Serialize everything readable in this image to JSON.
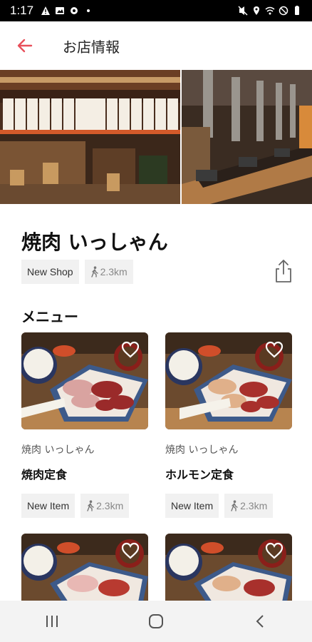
{
  "status": {
    "time": "1:17"
  },
  "header": {
    "title": "お店情報"
  },
  "shop": {
    "name": "焼肉 いっしゃん",
    "tag": "New Shop",
    "distance": "2.3km"
  },
  "menu": {
    "section_title": "メニュー",
    "items": [
      {
        "shop": "焼肉 いっしゃん",
        "name": "焼肉定食",
        "tag": "New Item",
        "distance": "2.3km"
      },
      {
        "shop": "焼肉 いっしゃん",
        "name": "ホルモン定食",
        "tag": "New Item",
        "distance": "2.3km"
      },
      {
        "shop": "",
        "name": "",
        "tag": "",
        "distance": ""
      },
      {
        "shop": "",
        "name": "",
        "tag": "",
        "distance": ""
      }
    ]
  },
  "colors": {
    "accent": "#e8505b",
    "chip_bg": "#f1f1f1"
  },
  "icons": {
    "back": "arrow-left-icon",
    "share": "share-icon",
    "walk": "walking-person-icon",
    "favorite": "heart-icon"
  }
}
